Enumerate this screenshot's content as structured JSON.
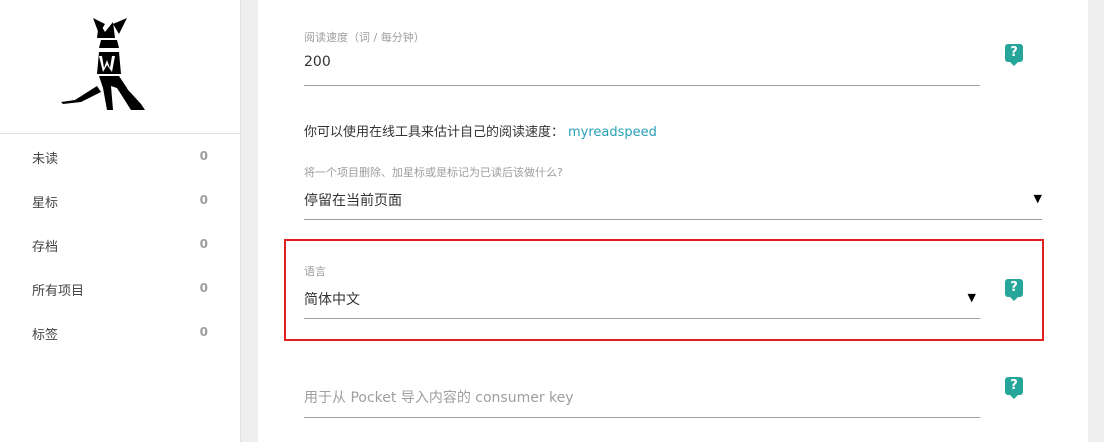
{
  "sidebar": {
    "items": [
      {
        "label": "未读",
        "count": "0"
      },
      {
        "label": "星标",
        "count": "0"
      },
      {
        "label": "存档",
        "count": "0"
      },
      {
        "label": "所有项目",
        "count": "0"
      },
      {
        "label": "标签",
        "count": "0"
      }
    ]
  },
  "settings": {
    "reading_speed": {
      "label": "阅读速度（词 / 每分钟）",
      "value": "200"
    },
    "info": {
      "text": "你可以使用在线工具来估计自己的阅读速度：",
      "link": "myreadspeed"
    },
    "action_after": {
      "label": "将一个项目删除、加星标或是标记为已读后该做什么?",
      "value": "停留在当前页面"
    },
    "language": {
      "label": "语言",
      "value": "简体中文"
    },
    "pocket_key": {
      "placeholder": "用于从 Pocket 导入内容的 consumer key"
    },
    "help_glyph": "?",
    "dropdown_arrow": "▼"
  },
  "colors": {
    "accent": "#26a69a",
    "link": "#26a0b7",
    "highlight": "#e02020"
  }
}
